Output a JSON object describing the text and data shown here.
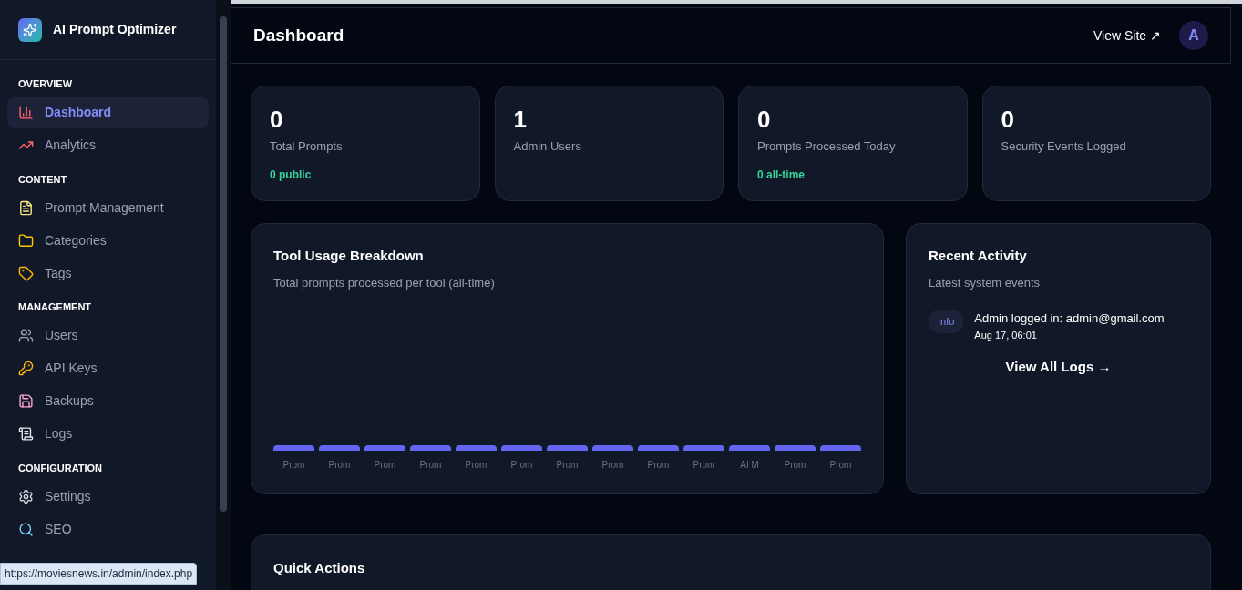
{
  "sidebar": {
    "brand": "AI Prompt Optimizer",
    "sections": [
      {
        "title": "OVERVIEW",
        "items": [
          {
            "label": "Dashboard",
            "selected": true
          },
          {
            "label": "Analytics",
            "selected": false
          }
        ]
      },
      {
        "title": "CONTENT",
        "items": [
          {
            "label": "Prompt Management",
            "selected": false
          },
          {
            "label": "Categories",
            "selected": false
          },
          {
            "label": "Tags",
            "selected": false
          }
        ]
      },
      {
        "title": "MANAGEMENT",
        "items": [
          {
            "label": "Users",
            "selected": false
          },
          {
            "label": "API Keys",
            "selected": false
          },
          {
            "label": "Backups",
            "selected": false
          },
          {
            "label": "Logs",
            "selected": false
          }
        ]
      },
      {
        "title": "CONFIGURATION",
        "items": [
          {
            "label": "Settings",
            "selected": false
          },
          {
            "label": "SEO",
            "selected": false
          }
        ]
      }
    ]
  },
  "header": {
    "title": "Dashboard",
    "view_site": "View Site ↗",
    "avatar": "A"
  },
  "stats": [
    {
      "value": "0",
      "label": "Total Prompts",
      "note": "0 public"
    },
    {
      "value": "1",
      "label": "Admin Users"
    },
    {
      "value": "0",
      "label": "Prompts Processed Today",
      "note": "0 all-time"
    },
    {
      "value": "0",
      "label": "Security Events Logged"
    }
  ],
  "tool_usage": {
    "title": "Tool Usage Breakdown",
    "subtitle": "Total prompts processed per tool (all-time)",
    "bar_labels": [
      "Prom",
      "Prom",
      "Prom",
      "Prom",
      "Prom",
      "Prom",
      "Prom",
      "Prom",
      "Prom",
      "Prom",
      "AI M",
      "Prom",
      "Prom"
    ]
  },
  "recent_activity": {
    "title": "Recent Activity",
    "subtitle": "Latest system events",
    "events": [
      {
        "badge": "Info",
        "message": "Admin logged in: admin@gmail.com",
        "time": "Aug 17, 06:01"
      }
    ],
    "link": "View All Logs →"
  },
  "quick_actions": {
    "title": "Quick Actions"
  },
  "status_url": "https://moviesnews.in/admin/index.php"
}
